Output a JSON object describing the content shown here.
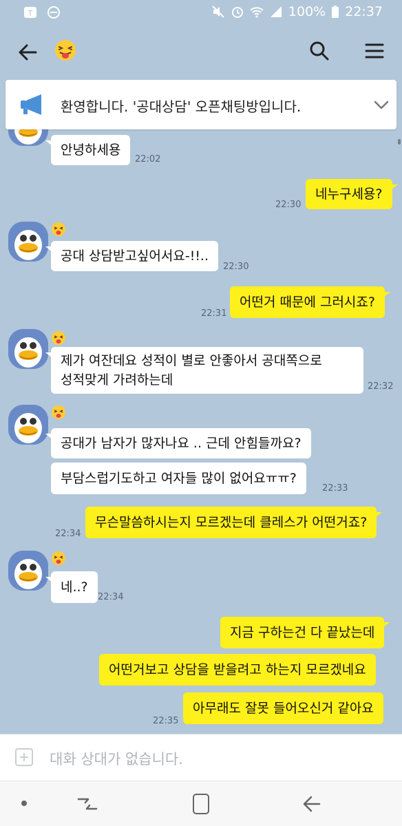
{
  "status_bar": {
    "battery": "100%",
    "time": "22:37"
  },
  "header": {
    "emoji_icon": "tongue-out-face-emoji"
  },
  "notice": {
    "text": "환영합니다. '공대상담' 오픈채팅방입니다."
  },
  "messages": [
    {
      "from": "them",
      "text": "안녕하세용",
      "time": "22:02"
    },
    {
      "from": "me",
      "text": "네누구세용?",
      "time": "22:30"
    },
    {
      "from": "them",
      "text": "공대 상담받고싶어서요-!!..",
      "time": "22:30"
    },
    {
      "from": "me",
      "text": "어떤거 때문에 그러시죠?",
      "time": "22:31"
    },
    {
      "from": "them",
      "text_line1": "제가 여잔데요 성적이 별로 안좋아서 공대쪽으로",
      "text_line2": "성적맞게 가려하는데",
      "time": "22:32"
    },
    {
      "from": "them",
      "text": "공대가 남자가 많자나요 .. 근데 안힘들까요?"
    },
    {
      "from": "them",
      "text": "부담스럽기도하고 여자들 많이 없어요ㅠㅠ?",
      "time": "22:33"
    },
    {
      "from": "me",
      "text": "무슨말씀하시는지 모르겠는데 클레스가 어떤거죠?",
      "time": "22:34"
    },
    {
      "from": "them",
      "text": "네..?",
      "time": "22:34"
    },
    {
      "from": "me",
      "text": "지금 구하는건 다 끝났는데"
    },
    {
      "from": "me",
      "text": "어떤거보고 상담을 받을려고 하는지 모르겠네요"
    },
    {
      "from": "me",
      "text": "아무래도 잘못 들어오신거 같아요",
      "time": "22:35"
    }
  ],
  "input": {
    "placeholder": "대화 상대가 없습니다."
  },
  "colors": {
    "background": "#b2c7d9",
    "my_bubble": "#fef01b",
    "their_bubble": "#ffffff"
  }
}
